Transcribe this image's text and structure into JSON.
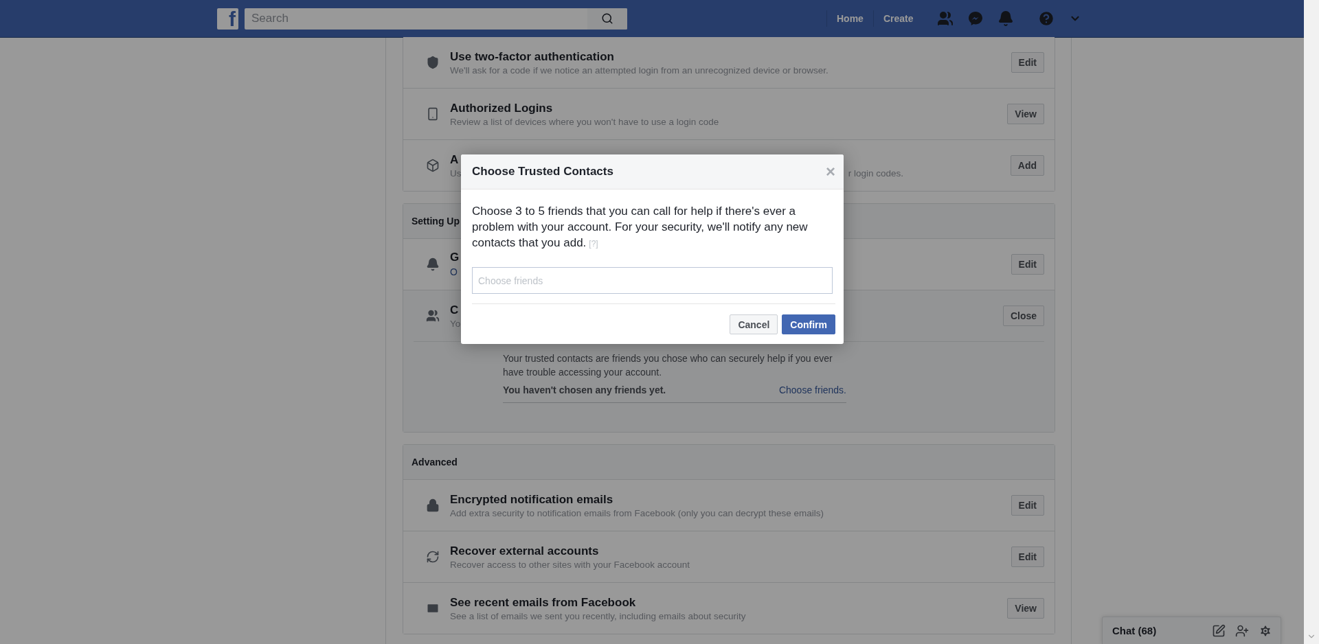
{
  "topbar": {
    "logo": "f",
    "search": {
      "placeholder": "Search"
    },
    "nav": [
      {
        "label": "Home"
      },
      {
        "label": "Create"
      }
    ]
  },
  "sections": [
    {
      "rows": [
        {
          "title": "Use two-factor authentication",
          "description": [
            "We'll ask for a code if we notice an attempted login from an unrecognized device or browser."
          ],
          "button": "Edit"
        },
        {
          "title": "Authorized Logins",
          "description": [
            "Review a list of devices where you won't have to use a login code"
          ],
          "button": "View"
        },
        {
          "title": "A",
          "description": [
            "Us",
            "r login codes."
          ],
          "button": "Add"
        }
      ]
    },
    {
      "header": "Setting Up",
      "rows": [
        {
          "title": "G",
          "link": "O",
          "button": "Edit"
        },
        {
          "title": "C",
          "description": [
            "Yo"
          ],
          "button": "Close",
          "expanded": true,
          "detail": {
            "text": "Your trusted contacts are friends you chose who can securely help if you ever have trouble accessing your account.",
            "status": "You haven't chosen any friends yet.",
            "link": "Choose friends."
          }
        }
      ]
    },
    {
      "header": "Advanced",
      "rows": [
        {
          "title": "Encrypted notification emails",
          "description": [
            "Add extra security to notification emails from Facebook (only you can decrypt these emails)"
          ],
          "button": "Edit"
        },
        {
          "title": "Recover external accounts",
          "description": [
            "Recover access to other sites with your Facebook account"
          ],
          "button": "Edit"
        },
        {
          "title": "See recent emails from Facebook",
          "description": [
            "See a list of emails we sent you recently, including emails about security"
          ],
          "button": "View"
        }
      ]
    }
  ],
  "modal": {
    "title": "Choose Trusted Contacts",
    "close": "×",
    "body": "Choose 3 to 5 friends that you can call for help if there's ever a problem with your account. For your security, we'll notify any new contacts that you add.",
    "help": "[?]",
    "field": {
      "placeholder": "Choose friends"
    },
    "buttons": [
      {
        "label": "Cancel",
        "kind": "secondary"
      },
      {
        "label": "Confirm",
        "kind": "primary"
      }
    ]
  },
  "chat": {
    "label": "Chat (68)"
  }
}
